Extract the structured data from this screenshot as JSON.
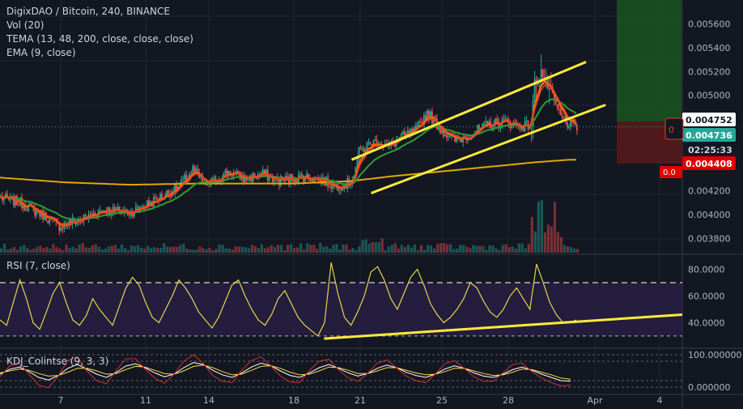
{
  "header": {
    "symbol_line": "DigixDAO / Bitcoin, 240, BINANCE",
    "studies": [
      "Vol (20)",
      "TEMA (13, 48, 200, close, close, close)",
      "EMA (9, close)"
    ]
  },
  "rsi_panel": {
    "title": "RSI (7, close)"
  },
  "kdj_panel": {
    "title": "KDJ_Colintse (9, 3, 3)"
  },
  "colors": {
    "background": "#131722",
    "up": "#26a69a",
    "down": "#ef5350",
    "tema_fast": "#ef6c00",
    "tema_mid": "#2e9e2e",
    "tema_slow": "#e0a800",
    "ema": "#e53935",
    "trendline": "#ffeb3b",
    "rsi_line": "#e6d54a",
    "rsi_band": "#2a1f45",
    "kdj_k": "#ffffff",
    "kdj_d": "#ffd740",
    "kdj_j": "#d32f2f",
    "profit_zone": "#1b5e20",
    "loss_zone": "#5a1a1a"
  },
  "chart_data": [
    {
      "type": "candlestick",
      "name": "price",
      "ylim": [
        0.00368,
        0.0058
      ],
      "y_ticks": [
        "0.005600",
        "0.005400",
        "0.005200",
        "0.005000",
        "0.004200",
        "0.004000",
        "0.003800"
      ],
      "x_ticks": [
        "7",
        "11",
        "14",
        "18",
        "21",
        "25",
        "28",
        "Apr",
        "4"
      ],
      "price_labels": {
        "upper": "0.004752",
        "current": "0.004736",
        "countdown": "02:25:33",
        "lower": "0.004408"
      },
      "overlay_markers": [
        "0",
        "0.0"
      ],
      "anchors": [
        [
          0,
          0.00414
        ],
        [
          12,
          0.0041
        ],
        [
          28,
          0.00398
        ],
        [
          35,
          0.0039
        ],
        [
          50,
          0.00396
        ],
        [
          62,
          0.00404
        ],
        [
          80,
          0.00402
        ],
        [
          95,
          0.00412
        ],
        [
          110,
          0.00424
        ],
        [
          118,
          0.00438
        ],
        [
          126,
          0.00424
        ],
        [
          140,
          0.00436
        ],
        [
          150,
          0.0043
        ],
        [
          162,
          0.00434
        ],
        [
          170,
          0.00428
        ],
        [
          185,
          0.00432
        ],
        [
          195,
          0.0043
        ],
        [
          205,
          0.00424
        ],
        [
          214,
          0.00426
        ],
        [
          217,
          0.00434
        ],
        [
          220,
          0.00452
        ],
        [
          225,
          0.00458
        ],
        [
          232,
          0.00462
        ],
        [
          238,
          0.00456
        ],
        [
          245,
          0.00464
        ],
        [
          255,
          0.0047
        ],
        [
          262,
          0.00486
        ],
        [
          270,
          0.00472
        ],
        [
          278,
          0.00462
        ],
        [
          283,
          0.00464
        ],
        [
          292,
          0.0047
        ],
        [
          300,
          0.00476
        ],
        [
          310,
          0.00478
        ],
        [
          320,
          0.00474
        ],
        [
          326,
          0.00476
        ],
        [
          328,
          0.0051
        ],
        [
          332,
          0.0052
        ],
        [
          336,
          0.00508
        ],
        [
          340,
          0.00494
        ],
        [
          344,
          0.00482
        ],
        [
          350,
          0.00474
        ]
      ],
      "tema_slow": [
        [
          0,
          0.00431
        ],
        [
          40,
          0.00427
        ],
        [
          80,
          0.00425
        ],
        [
          120,
          0.00426
        ],
        [
          180,
          0.00426
        ],
        [
          215,
          0.00428
        ],
        [
          240,
          0.00432
        ],
        [
          270,
          0.00436
        ],
        [
          300,
          0.0044
        ],
        [
          330,
          0.00444
        ],
        [
          350,
          0.00446
        ]
      ],
      "trendlines": [
        {
          "from": [
            216,
            0.00446
          ],
          "to": [
            360,
            0.00528
          ]
        },
        {
          "from": [
            228,
            0.00418
          ],
          "to": [
            372,
            0.00492
          ]
        }
      ]
    },
    {
      "type": "line",
      "name": "RSI (7, close)",
      "ylim": [
        22,
        90
      ],
      "y_ticks": [
        "80.0000",
        "60.0000",
        "40.0000"
      ],
      "levels": [
        70,
        30
      ],
      "values": [
        42,
        38,
        55,
        72,
        58,
        40,
        35,
        48,
        62,
        70,
        55,
        42,
        38,
        45,
        58,
        50,
        44,
        38,
        52,
        66,
        74,
        68,
        55,
        44,
        40,
        50,
        60,
        72,
        66,
        58,
        48,
        42,
        36,
        44,
        56,
        68,
        72,
        60,
        50,
        42,
        38,
        46,
        58,
        64,
        54,
        44,
        38,
        34,
        30,
        40,
        85,
        62,
        44,
        38,
        48,
        60,
        78,
        82,
        72,
        58,
        50,
        62,
        74,
        80,
        68,
        54,
        46,
        40,
        44,
        50,
        58,
        70,
        66,
        56,
        48,
        44,
        50,
        60,
        66,
        58,
        50,
        84,
        70,
        55,
        46,
        40,
        40,
        42
      ],
      "trendline": {
        "from": [
          0.475,
          28
        ],
        "to": [
          1.0,
          46
        ]
      }
    },
    {
      "type": "line",
      "name": "KDJ_Colintse (9, 3, 3)",
      "ylim": [
        -10,
        115
      ],
      "y_ticks": [
        "100.000000",
        "0.000000"
      ],
      "series": [
        {
          "values": [
            40,
            55,
            62,
            48,
            30,
            22,
            35,
            58,
            70,
            55,
            40,
            30,
            45,
            65,
            72,
            60,
            44,
            32,
            40,
            60,
            76,
            70,
            52,
            38,
            30,
            44,
            62,
            74,
            66,
            50,
            36,
            30,
            44,
            60,
            70,
            58,
            44,
            34,
            42,
            58,
            68,
            60,
            46,
            36,
            30,
            40,
            56,
            66,
            58,
            44,
            34,
            30,
            40,
            54,
            62,
            52,
            40,
            30,
            20,
            18
          ]
        },
        {
          "values": [
            44,
            50,
            56,
            52,
            42,
            34,
            36,
            46,
            58,
            58,
            50,
            40,
            42,
            54,
            64,
            62,
            52,
            42,
            40,
            50,
            64,
            68,
            60,
            48,
            38,
            40,
            52,
            64,
            66,
            58,
            46,
            38,
            40,
            50,
            62,
            60,
            52,
            42,
            42,
            50,
            60,
            60,
            52,
            44,
            38,
            40,
            48,
            58,
            58,
            50,
            42,
            36,
            38,
            46,
            56,
            54,
            46,
            38,
            28,
            24
          ]
        },
        {
          "values": [
            32,
            65,
            74,
            40,
            6,
            -2,
            33,
            82,
            94,
            49,
            20,
            10,
            51,
            87,
            88,
            56,
            28,
            12,
            40,
            80,
            100,
            74,
            36,
            18,
            14,
            52,
            82,
            94,
            66,
            34,
            16,
            14,
            52,
            80,
            86,
            54,
            28,
            18,
            42,
            74,
            84,
            60,
            34,
            20,
            14,
            40,
            72,
            82,
            58,
            32,
            18,
            18,
            44,
            70,
            74,
            48,
            28,
            14,
            4,
            6
          ]
        }
      ]
    }
  ]
}
